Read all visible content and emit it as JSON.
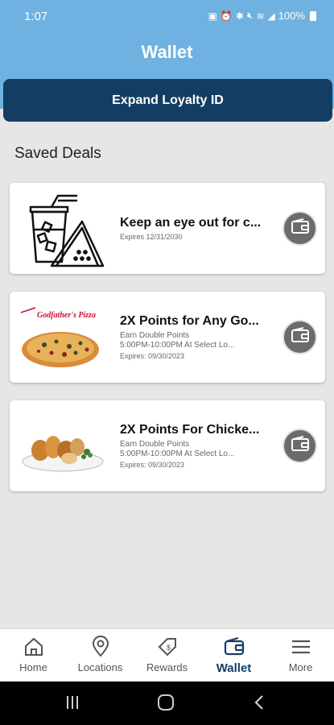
{
  "status_bar": {
    "time": "1:07",
    "battery": "100%"
  },
  "header": {
    "title": "Wallet",
    "loyalty_button": "Expand Loyalty ID"
  },
  "saved_deals": {
    "title": "Saved Deals",
    "items": [
      {
        "title": "Keep an eye out for c...",
        "lines": [],
        "expires": "Expires 12/31/2030",
        "image": "drink-and-pizza-slice-icon"
      },
      {
        "title": "2X Points for Any Go...",
        "lines": [
          "Earn Double Points",
          "5:00PM-10:00PM At Select Lo..."
        ],
        "expires": "Expires: 09/30/2023",
        "image": "godfathers-pizza-photo",
        "logo_text": "Godfather's Pizza"
      },
      {
        "title": "2X Points For Chicke...",
        "lines": [
          "Earn Double Points",
          "5:00PM-10:00PM At Select Lo..."
        ],
        "expires": "Expires: 09/30/2023",
        "image": "chicken-platter-photo"
      }
    ]
  },
  "bottom_nav": [
    {
      "label": "Home",
      "icon": "home-icon",
      "active": false
    },
    {
      "label": "Locations",
      "icon": "location-pin-icon",
      "active": false
    },
    {
      "label": "Rewards",
      "icon": "rewards-tag-icon",
      "active": false
    },
    {
      "label": "Wallet",
      "icon": "wallet-icon",
      "active": true
    },
    {
      "label": "More",
      "icon": "menu-icon",
      "active": false
    }
  ],
  "colors": {
    "header": "#6fb1e0",
    "loyalty_button": "#143d63",
    "wallet_button": "#6b6b6b",
    "active_nav": "#143d63"
  }
}
